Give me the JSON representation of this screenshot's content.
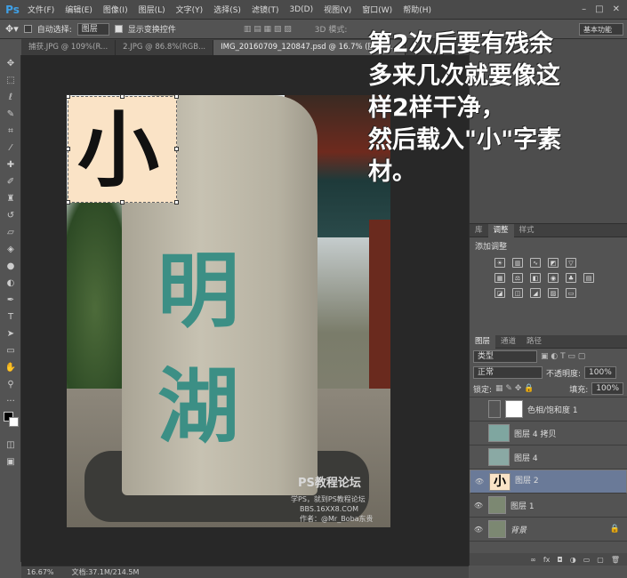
{
  "app": {
    "logo": "Ps"
  },
  "menu": [
    "文件(F)",
    "编辑(E)",
    "图像(I)",
    "图层(L)",
    "文字(Y)",
    "选择(S)",
    "滤镜(T)",
    "3D(D)",
    "视图(V)",
    "窗口(W)",
    "帮助(H)"
  ],
  "window_controls": [
    "–",
    "□",
    "✕"
  ],
  "options": {
    "auto_select_label": "自动选择:",
    "auto_select_value": "图层",
    "show_transform_label": "显示变换控件",
    "mode_3d_label": "3D 模式:",
    "workspace": "基本功能"
  },
  "tabs": [
    {
      "label": "捕获.JPG @ 109%(R...",
      "active": false
    },
    {
      "label": "2.JPG @ 86.8%(RGB...",
      "active": false
    },
    {
      "label": "IMG_20160709_120847.psd @ 16.7% (图层 2...",
      "active": true
    }
  ],
  "overlay_lines": [
    "第2次后要有残余",
    "多来几次就要像这",
    "样2样干净，",
    "然后载入\"小\"字素",
    "材。"
  ],
  "canvas": {
    "layer_char": "小",
    "stone_chars": [
      "明",
      "湖"
    ],
    "watermark_title": "PS教程论坛",
    "watermark_sub": "学PS，就到PS教程论坛",
    "watermark_url": "BBS.16XX8.COM",
    "watermark_author": "作者：@Mr_Boba东贵"
  },
  "right_panel": {
    "top_tabs": [
      "库",
      "调整",
      "样式"
    ],
    "adjust_title": "添加调整",
    "layer_tabs": [
      "图层",
      "通道",
      "路径"
    ],
    "filter_label": "类型",
    "blend_mode": "正常",
    "opacity_label": "不透明度:",
    "opacity_value": "100%",
    "lock_label": "锁定:",
    "fill_label": "填充:",
    "fill_value": "100%",
    "layers": [
      {
        "name": "色相/饱和度 1",
        "visible": false,
        "selected": false,
        "kind": "adjust"
      },
      {
        "name": "图层 4 拷贝",
        "visible": false,
        "selected": false,
        "kind": "img"
      },
      {
        "name": "图层 4",
        "visible": false,
        "selected": false,
        "kind": "img"
      },
      {
        "name": "图层 2",
        "visible": true,
        "selected": true,
        "kind": "char"
      },
      {
        "name": "图层 1",
        "visible": true,
        "selected": false,
        "kind": "photo"
      },
      {
        "name": "背景",
        "visible": true,
        "selected": false,
        "kind": "photo"
      }
    ],
    "bottom_icons": [
      "∞",
      "fx",
      "◘",
      "◑",
      "▭",
      "▢",
      "🗑"
    ]
  },
  "status": {
    "zoom": "16.67%",
    "doc_label": "文档:37.1M/214.5M"
  }
}
